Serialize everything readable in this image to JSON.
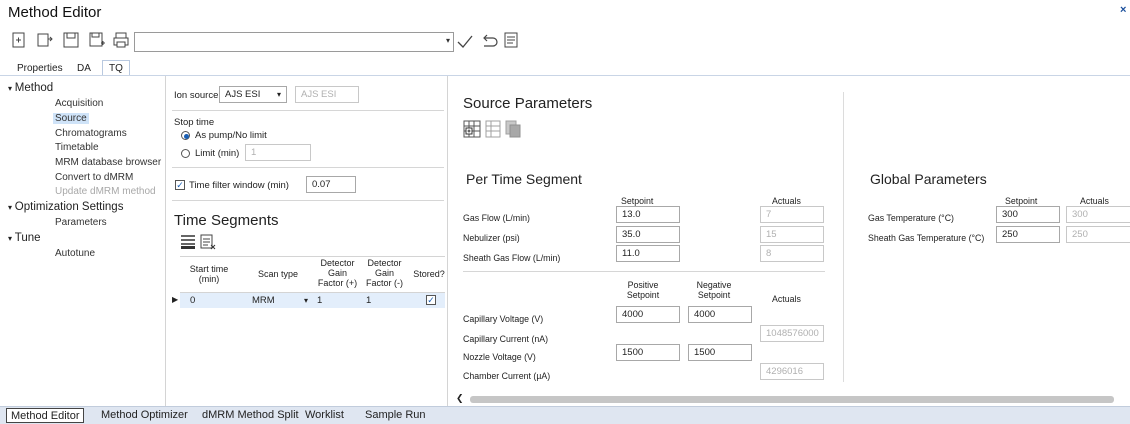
{
  "window": {
    "title": "Method Editor",
    "close_glyph": "×"
  },
  "toolbar": {
    "icons": [
      "new-icon",
      "open-icon",
      "save-icon",
      "save-as-icon",
      "print-icon"
    ],
    "combo_value": "",
    "combo_arrow": "▾",
    "right_icons": [
      "checkmark-icon",
      "undo-icon",
      "checklist-icon"
    ]
  },
  "tabs": [
    {
      "label": "Properties"
    },
    {
      "label": "DA"
    },
    {
      "label": "TQ"
    }
  ],
  "tree": {
    "method": "Method",
    "method_items": [
      "Acquisition",
      "Source",
      "Chromatograms",
      "Timetable",
      "MRM database browser",
      "Convert to dMRM",
      "Update dMRM method"
    ],
    "optimization": "Optimization Settings",
    "optimization_items": [
      "Parameters"
    ],
    "tune": "Tune",
    "tune_items": [
      "Autotune"
    ]
  },
  "ion_source": {
    "label": "Ion source",
    "value": "AJS ESI",
    "readonly": "AJS ESI"
  },
  "stop_time": {
    "label": "Stop time",
    "opt1": "As pump/No limit",
    "opt2": "Limit (min)",
    "limit_value": "1"
  },
  "time_filter": {
    "label": "Time filter window (min)",
    "value": "0.07"
  },
  "time_segments": {
    "title": "Time Segments",
    "columns": {
      "start": "Start time (min)",
      "scan": "Scan type",
      "gain_pos": "Detector Gain Factor (+)",
      "gain_neg": "Detector Gain Factor (-)",
      "stored": "Stored?"
    },
    "row": {
      "start": "0",
      "scan": "MRM",
      "gain_pos": "1",
      "gain_neg": "1"
    }
  },
  "source_parameters": {
    "title": "Source Parameters"
  },
  "per_time_segment": {
    "title": "Per Time Segment",
    "setpoint_label": "Setpoint",
    "actuals_label": "Actuals",
    "rows": [
      {
        "label": "Gas Flow (L/min)",
        "setpoint": "13.0",
        "actual": "7"
      },
      {
        "label": "Nebulizer (psi)",
        "setpoint": "35.0",
        "actual": "15"
      },
      {
        "label": "Sheath Gas Flow (L/min)",
        "setpoint": "11.0",
        "actual": "8"
      }
    ],
    "positive_label": "Positive Setpoint",
    "negative_label": "Negative Setpoint",
    "capillary_voltage": {
      "label": "Capillary Voltage (V)",
      "pos": "4000",
      "neg": "4000"
    },
    "capillary_current": {
      "label": "Capillary Current (nA)",
      "actual": "1048576000"
    },
    "nozzle_voltage": {
      "label": "Nozzle Voltage (V)",
      "pos": "1500",
      "neg": "1500"
    },
    "chamber_current": {
      "label": "Chamber Current (µA)",
      "actual": "4296016"
    }
  },
  "global_parameters": {
    "title": "Global Parameters",
    "setpoint_label": "Setpoint",
    "actuals_label": "Actuals",
    "rows": [
      {
        "label": "Gas Temperature (°C)",
        "setpoint": "300",
        "actual": "300"
      },
      {
        "label": "Sheath Gas Temperature (°C)",
        "setpoint": "250",
        "actual": "250"
      }
    ]
  },
  "taskbar": [
    "Method Editor",
    "Method Optimizer",
    "dMRM Method Split",
    "Worklist",
    "Sample Run"
  ]
}
